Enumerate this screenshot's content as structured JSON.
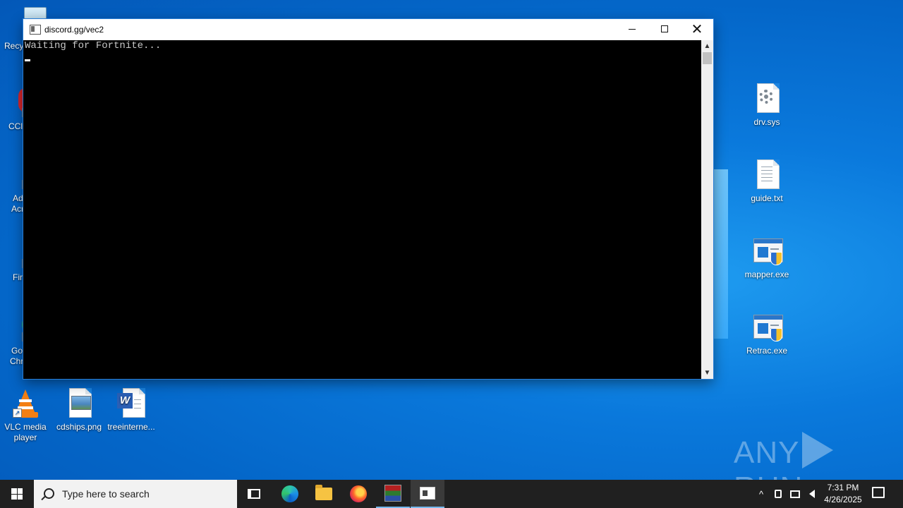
{
  "desktop": {
    "icons_left_partial": [
      {
        "label": "Recy"
      },
      {
        "label": "CCl"
      },
      {
        "label": "Ad",
        "label2": "Acr"
      },
      {
        "label": "Fir"
      },
      {
        "label": "Go",
        "label2": "Chr"
      }
    ],
    "icons_bottom": [
      {
        "label": "VLC media",
        "label2": "player"
      },
      {
        "label": "cdships.png"
      },
      {
        "label": "treeinterne..."
      }
    ],
    "icons_right": [
      {
        "label": "drv.sys"
      },
      {
        "label": "guide.txt"
      },
      {
        "label": "mapper.exe"
      },
      {
        "label": "Retrac.exe"
      }
    ]
  },
  "console_window": {
    "title": "discord.gg/vec2",
    "output": "Waiting for Fortnite...",
    "minimize_glyph": "",
    "maximize_glyph": "",
    "close_glyph": "✕",
    "scroll_up": "▲",
    "scroll_down": "▼"
  },
  "watermark": {
    "left": "ANY",
    "right": "RUN"
  },
  "taskbar": {
    "search_placeholder": "Type here to search",
    "pinned": [
      "task-view",
      "edge",
      "file-explorer",
      "firefox",
      "winrar",
      "console"
    ],
    "tray": {
      "chevron": "^",
      "time": "7:31 PM",
      "date": "4/26/2025"
    }
  },
  "colors": {
    "accent": "#76b9ed",
    "taskbar": "#202020",
    "desktop": "#0a79dc"
  }
}
